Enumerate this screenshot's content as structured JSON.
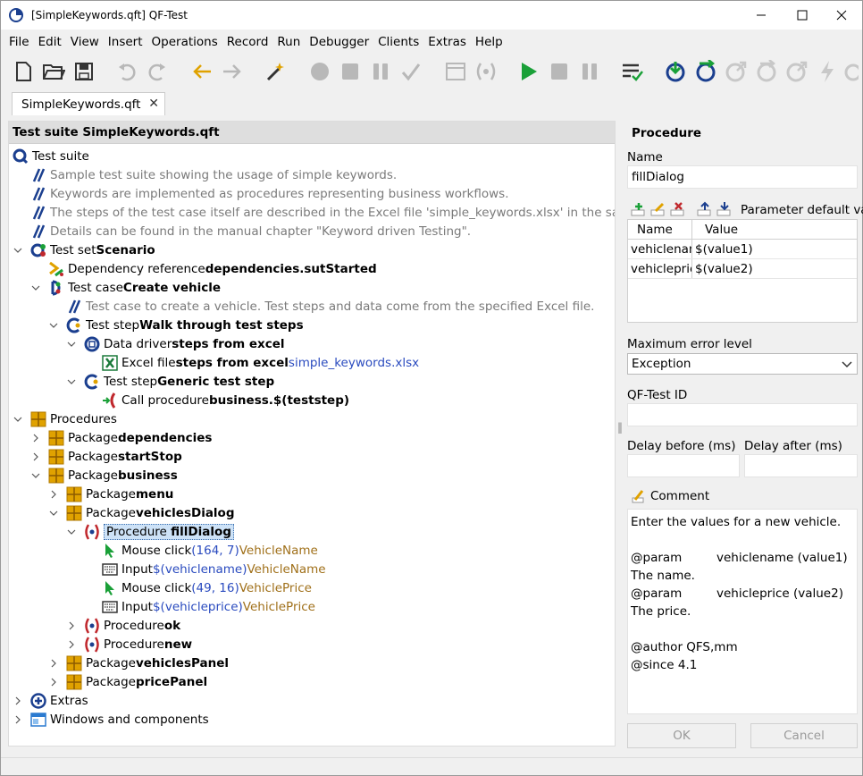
{
  "window": {
    "title": "[SimpleKeywords.qft] QF-Test"
  },
  "menu": [
    "File",
    "Edit",
    "View",
    "Insert",
    "Operations",
    "Record",
    "Run",
    "Debugger",
    "Clients",
    "Extras",
    "Help"
  ],
  "tab": {
    "label": "SimpleKeywords.qft",
    "close": "✕"
  },
  "tree": {
    "header": "Test suite SimpleKeywords.qft",
    "rows": [
      {
        "text": "Test suite"
      },
      {
        "text": "Sample test suite showing the usage of simple keywords."
      },
      {
        "text": "Keywords are implemented as procedures representing business workflows."
      },
      {
        "text": "The steps of the test case itself are described in the Excel file 'simple_keywords.xlsx' in the same folder."
      },
      {
        "text": "Details can be found in the manual chapter \"Keyword driven Testing\"."
      },
      {
        "pre": "Test set ",
        "name": "Scenario"
      },
      {
        "pre": "Dependency reference ",
        "name": "dependencies.sutStarted"
      },
      {
        "pre": "Test case ",
        "name": "Create vehicle"
      },
      {
        "text": "Test case to create a vehicle. Test steps and data come from the specified Excel file."
      },
      {
        "pre": "Test step ",
        "name": "Walk through test steps"
      },
      {
        "pre": "Data driver ",
        "name": "steps from excel"
      },
      {
        "pre": "Excel file ",
        "name": "steps from excel",
        "extra": " simple_keywords.xlsx"
      },
      {
        "pre": "Test step ",
        "name": "Generic test step"
      },
      {
        "pre": "Call procedure ",
        "name": "business.$(teststep)"
      },
      {
        "text": "Procedures"
      },
      {
        "pre": "Package ",
        "name": "dependencies"
      },
      {
        "pre": "Package ",
        "name": "startStop"
      },
      {
        "pre": "Package ",
        "name": "business"
      },
      {
        "pre": "Package ",
        "name": "menu"
      },
      {
        "pre": "Package ",
        "name": "vehiclesDialog"
      },
      {
        "pre": "Procedure ",
        "name": "fillDialog"
      },
      {
        "pre": "Mouse click ",
        "coord": "(164, 7)",
        "target": " VehicleName"
      },
      {
        "pre": "Input ",
        "coord": "$(vehiclename)",
        "target": " VehicleName"
      },
      {
        "pre": "Mouse click ",
        "coord": "(49, 16)",
        "target": " VehiclePrice"
      },
      {
        "pre": "Input ",
        "coord": "$(vehicleprice)",
        "target": " VehiclePrice"
      },
      {
        "pre": "Procedure ",
        "name": "ok"
      },
      {
        "pre": "Procedure ",
        "name": "new"
      },
      {
        "pre": "Package ",
        "name": "vehiclesPanel"
      },
      {
        "pre": "Package ",
        "name": "pricePanel"
      },
      {
        "text": "Extras"
      },
      {
        "text": "Windows and components"
      }
    ]
  },
  "detail": {
    "title": "Procedure",
    "name_label": "Name",
    "name_value": "fillDialog",
    "param_label": "Parameter default val",
    "param_headers": [
      "Name",
      "Value"
    ],
    "params": [
      {
        "name": "vehiclenam",
        "value": "$(value1)"
      },
      {
        "name": "vehicleprice",
        "value": "$(value2)"
      }
    ],
    "max_error_label": "Maximum error level",
    "max_error_value": "Exception",
    "qftest_id_label": "QF-Test ID",
    "delay_before_label": "Delay before (ms)",
    "delay_after_label": "Delay after (ms)",
    "comment_label": "Comment",
    "comment_lines": [
      {
        "k": "Enter the values for a new vehicle.",
        "v": ""
      },
      {
        "k": "",
        "v": ""
      },
      {
        "k": "@param",
        "v": "vehiclename (value1)"
      },
      {
        "k": "The name.",
        "v": ""
      },
      {
        "k": "@param",
        "v": "vehicleprice (value2)"
      },
      {
        "k": "The price.",
        "v": ""
      },
      {
        "k": "",
        "v": ""
      },
      {
        "k": "@author QFS,mm",
        "v": ""
      },
      {
        "k": "@since 4.1",
        "v": ""
      }
    ],
    "ok_label": "OK",
    "cancel_label": "Cancel"
  }
}
